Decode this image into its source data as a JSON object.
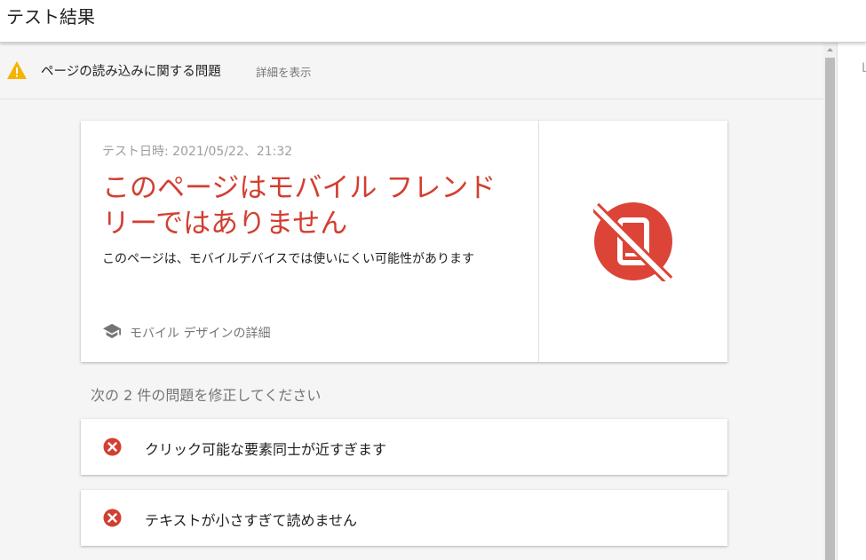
{
  "header": {
    "title": "テスト結果"
  },
  "warning": {
    "icon": "warning-triangle-icon",
    "color": "#f4b400",
    "text": "ページの読み込みに関する問題",
    "link": "詳細を表示"
  },
  "result": {
    "date": "テスト日時: 2021/05/22、21:32",
    "heading": "このページはモバイル フレンドリーではありません",
    "description": "このページは、モバイルデバイスでは使いにくい可能性があります",
    "learn_more": "モバイル デザインの詳細",
    "learn_icon": "school-icon",
    "status_icon": "not-mobile-friendly-icon",
    "status_color": "#db4437"
  },
  "issues": {
    "heading": "次の 2 件の問題を修正してください",
    "items": [
      {
        "label": "クリック可能な要素同士が近すぎます",
        "icon": "error-circle-icon"
      },
      {
        "label": "テキストが小さすぎて読めません",
        "icon": "error-circle-icon"
      }
    ],
    "error_color": "#d23f31"
  },
  "side_panel": {
    "edge_text": "L"
  }
}
